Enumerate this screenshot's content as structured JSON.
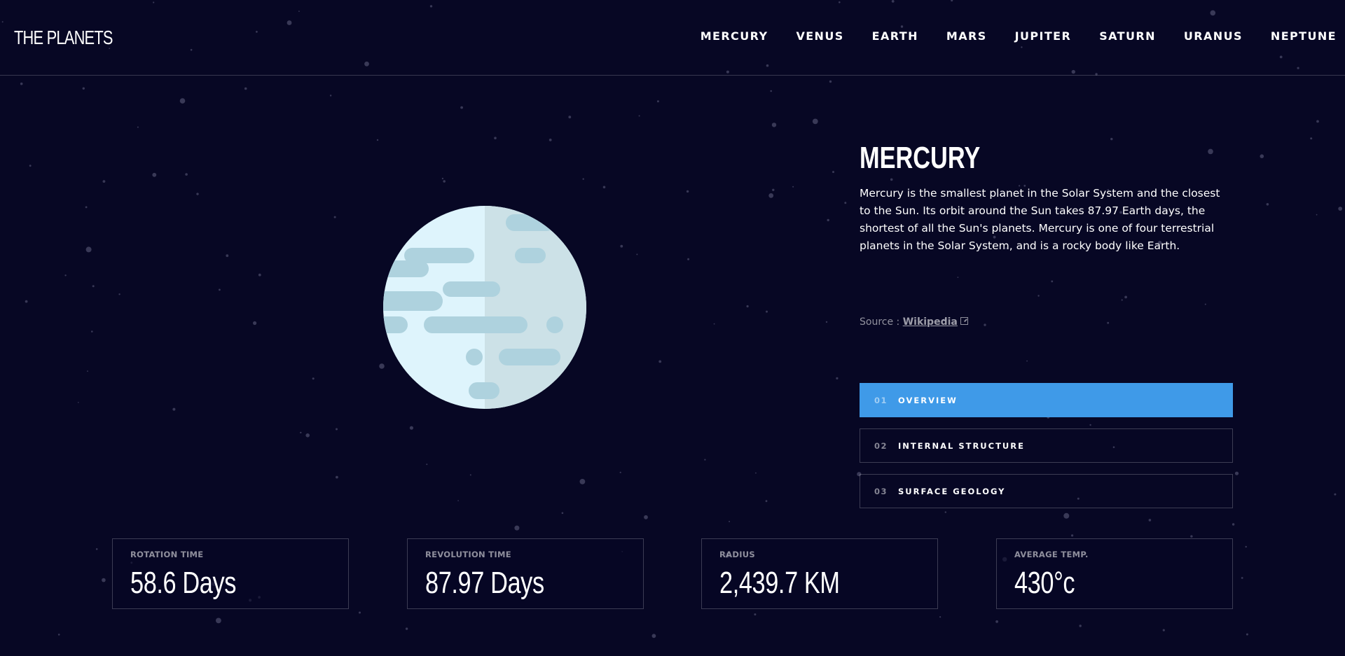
{
  "app": {
    "logo": "THE PLANETS"
  },
  "nav": {
    "items": [
      "MERCURY",
      "VENUS",
      "EARTH",
      "MARS",
      "JUPITER",
      "SATURN",
      "URANUS",
      "NEPTUNE"
    ]
  },
  "planet": {
    "name": "MERCURY",
    "description": "Mercury is the smallest planet in the Solar System and the closest to the Sun. Its orbit around the Sun takes 87.97 Earth days, the shortest of all the Sun's planets. Mercury is one of four terrestrial planets in the Solar System, and is a rocky body like Earth.",
    "source_prefix": "Source : ",
    "source_link": "Wikipedia",
    "image_icon": "mercury-planet-illustration"
  },
  "tabs": [
    {
      "num": "01",
      "label": "OVERVIEW",
      "active": true
    },
    {
      "num": "02",
      "label": "INTERNAL STRUCTURE",
      "active": false
    },
    {
      "num": "03",
      "label": "SURFACE GEOLOGY",
      "active": false
    }
  ],
  "stats": [
    {
      "label": "ROTATION TIME",
      "value": "58.6 Days"
    },
    {
      "label": "REVOLUTION TIME",
      "value": "87.97 Days"
    },
    {
      "label": "RADIUS",
      "value": "2,439.7 KM"
    },
    {
      "label": "AVERAGE TEMP.",
      "value": "430°c"
    }
  ],
  "colors": {
    "background": "#070724",
    "active_tab": "#3f9ae8",
    "planet_light": "#DEF4FC",
    "planet_shade": "#CCE1E7",
    "planet_spots": "#AED2DE"
  }
}
